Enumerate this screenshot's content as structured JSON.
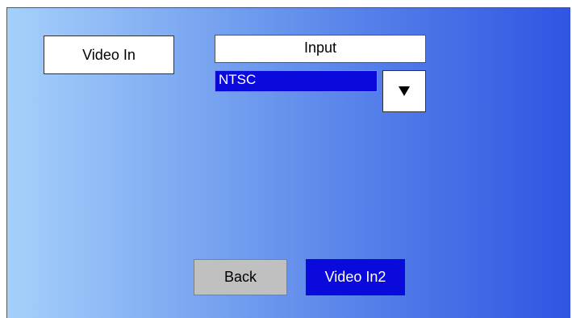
{
  "screen": {
    "title": "Video In",
    "input_header": "Input",
    "select": {
      "value": "NTSC"
    },
    "dropdown_icon": "triangle-down-icon",
    "buttons": {
      "back_label": "Back",
      "next_label": "Video In2"
    }
  },
  "colors": {
    "gradient_start": "#a6d0fb",
    "gradient_end": "#2f55e2",
    "selection_blue": "#0a0adc",
    "button_gray": "#c0c0c0"
  }
}
